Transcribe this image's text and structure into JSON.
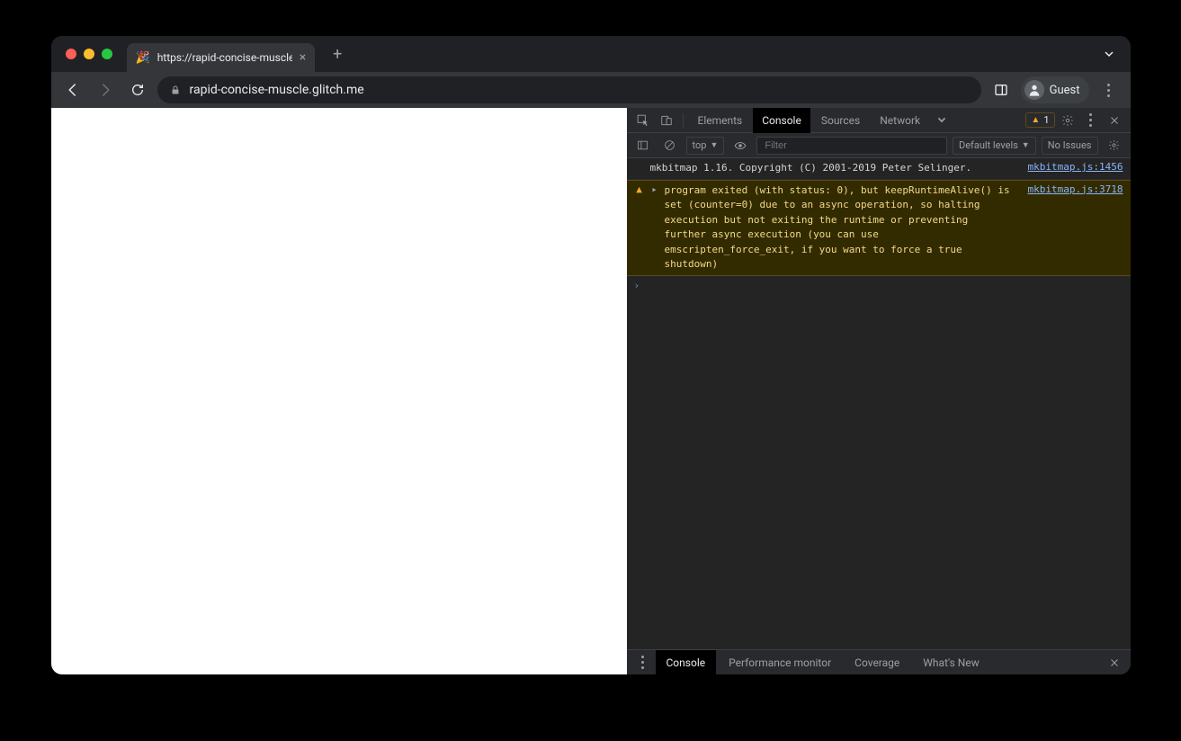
{
  "window": {
    "tab_title": "https://rapid-concise-muscle.g",
    "tab_favicon": "🎉"
  },
  "toolbar": {
    "url": "rapid-concise-muscle.glitch.me",
    "guest_label": "Guest"
  },
  "devtools": {
    "tabs": {
      "elements": "Elements",
      "console": "Console",
      "sources": "Sources",
      "network": "Network"
    },
    "warning_count": "1",
    "console_toolbar": {
      "context": "top",
      "filter_placeholder": "Filter",
      "levels": "Default levels",
      "issues": "No Issues"
    },
    "messages": {
      "info": {
        "text": "mkbitmap 1.16. Copyright (C) 2001-2019 Peter Selinger.",
        "source": "mkbitmap.js:1456"
      },
      "warn": {
        "text": "program exited (with status: 0), but keepRuntimeAlive() is set (counter=0) due to an async operation, so halting execution but not exiting the runtime or preventing further async execution (you can use emscripten_force_exit, if you want to force a true shutdown)",
        "source": "mkbitmap.js:3718"
      }
    },
    "drawer": {
      "console": "Console",
      "perf": "Performance monitor",
      "coverage": "Coverage",
      "whatsnew": "What's New"
    }
  }
}
